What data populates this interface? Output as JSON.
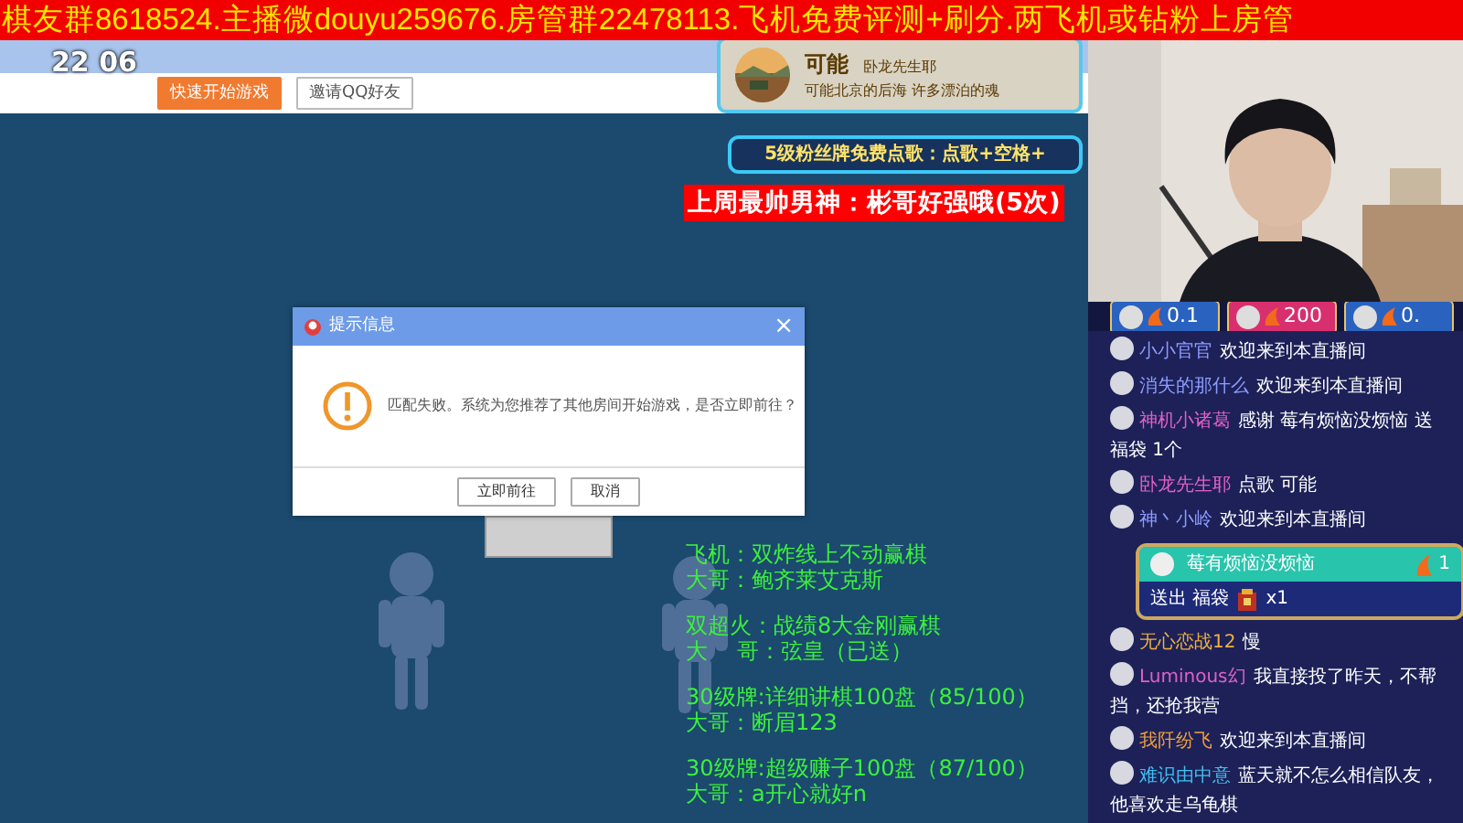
{
  "banner": {
    "text": "棋友群8618524.主播微douyu259676.房管群22478113.飞机免费评测+刷分.两飞机或钻粉上房管"
  },
  "game": {
    "clock": "22 06",
    "buttons": [
      {
        "label": "快速开始游戏",
        "primary": true
      },
      {
        "label": "邀请QQ好友",
        "primary": false
      }
    ],
    "dialog": {
      "title": "提示信息",
      "close": "×",
      "message": "匹配失败。系统为您推荐了其他房间开始游戏，是否立即前往？",
      "buttons": [
        "立即前往",
        "取消"
      ]
    },
    "board_text": [
      [
        "飞机：双炸线上不动赢棋",
        "大哥：鲍齐莱艾克斯"
      ],
      [
        "双超火：战绩8大金刚赢棋",
        "大　 哥：弦皇（已送）"
      ],
      [
        "30级牌:详细讲棋100盘（85/100）",
        "大哥：断眉123"
      ],
      [
        "30级牌:超级赚子100盘（87/100）",
        "大哥：a开心就好n"
      ]
    ]
  },
  "overlays": {
    "song_card": {
      "song": "可能",
      "requester": "卧龙先生耶",
      "lyric": "可能北京的后海 许多漂泊的魂"
    },
    "fan_notice": "5级粉丝牌免费点歌：点歌+空格+",
    "red_banner": "上周最帅男神：彬哥好强哦(5次)"
  },
  "gift_ranks": [
    {
      "value": "0.1",
      "color": "#2a62c0"
    },
    {
      "value": "200",
      "color": "#d8306e"
    },
    {
      "value": "0.",
      "color": "#2a62c0"
    }
  ],
  "chat": [
    {
      "kind": "message",
      "user": "小小官官",
      "color": "#8f9cff",
      "lines": [
        "欢迎来到本直播间"
      ]
    },
    {
      "kind": "message",
      "user": "消失的那什么",
      "color": "#8f9cff",
      "lines": [
        "欢迎来到本直播间"
      ]
    },
    {
      "kind": "message",
      "user": "神机小诸葛",
      "color": "#e060c8",
      "lines": [
        "感谢 莓有烦恼没烦恼 送",
        "福袋 1个"
      ]
    },
    {
      "kind": "message",
      "user": "卧龙先生耶",
      "color": "#e060c8",
      "lines": [
        "点歌 可能"
      ]
    },
    {
      "kind": "message",
      "user": "神丶小岭",
      "color": "#8f9cff",
      "lines": [
        "欢迎来到本直播间"
      ]
    },
    {
      "kind": "gift",
      "user": "莓有烦恼没烦恼",
      "count": "1",
      "lines": [
        "送出 福袋"
      ],
      "qty": "x1"
    },
    {
      "kind": "message",
      "user": "无心恋战12",
      "color": "#f0b040",
      "lines": [
        "慢"
      ]
    },
    {
      "kind": "message",
      "user": "Luminous幻",
      "color": "#e060c8",
      "lines": [
        "我直接投了昨天，不帮",
        "挡，还抢我营"
      ]
    },
    {
      "kind": "message",
      "user": "我阡纷飞",
      "color": "#f0a040",
      "lines": [
        "欢迎来到本直播间"
      ]
    },
    {
      "kind": "message",
      "user": "难识由中意",
      "color": "#40c0f0",
      "lines": [
        "蓝天就不怎么相信队友，",
        "他喜欢走乌龟棋"
      ]
    }
  ]
}
